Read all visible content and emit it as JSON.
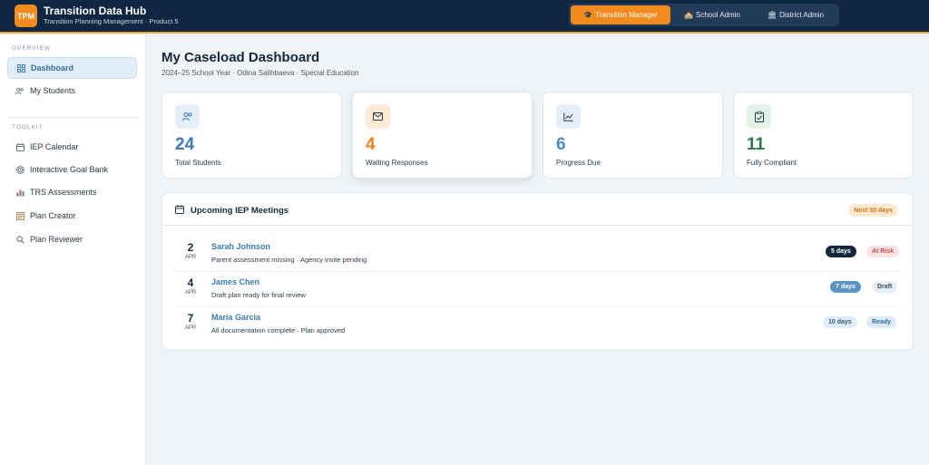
{
  "app": {
    "logo_text": "TPM",
    "title": "Transition Data Hub",
    "subtitle": "Transition Planning Management · Product 5",
    "accent": "#f28a1e",
    "nav_bg": "#0f2742"
  },
  "roles": [
    {
      "label": "Transition Manager",
      "icon": "graduation-cap-icon",
      "active": true
    },
    {
      "label": "School Admin",
      "icon": "school-icon",
      "active": false
    },
    {
      "label": "District Admin",
      "icon": "bank-icon",
      "active": false
    }
  ],
  "sidebar": {
    "overview_label": "OVERVIEW",
    "toolkit_label": "TOOLKIT",
    "overview_items": [
      {
        "label": "Dashboard",
        "icon": "grid-icon",
        "active": true
      },
      {
        "label": "My Students",
        "icon": "users-icon",
        "active": false
      }
    ],
    "toolkit_items": [
      {
        "label": "IEP Calendar",
        "icon": "calendar-icon"
      },
      {
        "label": "Interactive Goal Bank",
        "icon": "target-icon"
      },
      {
        "label": "TRS Assessments",
        "icon": "bar-chart-icon"
      },
      {
        "label": "Plan Creator",
        "icon": "document-icon"
      },
      {
        "label": "Plan Reviewer",
        "icon": "search-icon"
      }
    ]
  },
  "page": {
    "title": "My Caseload Dashboard",
    "subtitle": "2024–25 School Year · Odina Salihbaeva · Special Education"
  },
  "stats": [
    {
      "value": "24",
      "label": "Total Students",
      "icon": "users-icon",
      "color": "#3a7bb5",
      "bg": "#e4eef8"
    },
    {
      "value": "4",
      "label": "Waiting Responses",
      "icon": "mail-icon",
      "color": "#e8861c",
      "bg": "#fdebd6"
    },
    {
      "value": "6",
      "label": "Progress Due",
      "icon": "line-chart-icon",
      "color": "#4a8bc4",
      "bg": "#e4eef8"
    },
    {
      "value": "11",
      "label": "Fully Compliant",
      "icon": "clipboard-check-icon",
      "color": "#2f7a4a",
      "bg": "#e3f2e8"
    }
  ],
  "meetings": {
    "title": "Upcoming IEP Meetings",
    "range": "Next 30 days",
    "items": [
      {
        "day": "2",
        "month": "APR",
        "name": "Sarah Johnson",
        "note": "Parent assessment missing · Agency invite pending",
        "days": "5 days",
        "status": "At Risk"
      },
      {
        "day": "4",
        "month": "APR",
        "name": "James Chen",
        "note": "Draft plan ready for final review",
        "days": "7 days",
        "status": "Draft"
      },
      {
        "day": "7",
        "month": "APR",
        "name": "Maria Garcia",
        "note": "All documentation complete · Plan approved",
        "days": "10 days",
        "status": "Ready"
      }
    ]
  }
}
